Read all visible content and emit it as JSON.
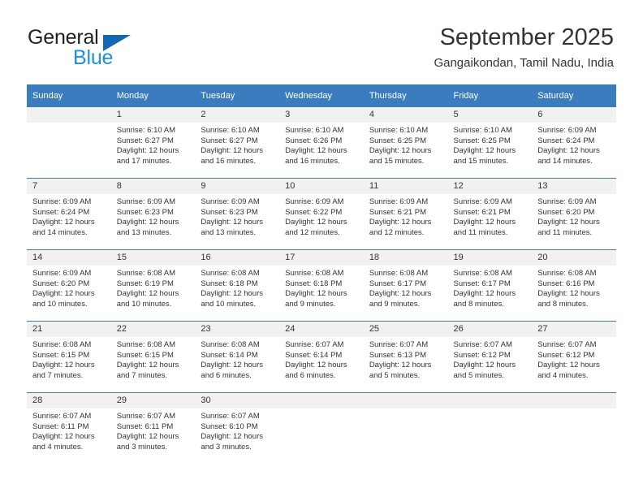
{
  "logo": {
    "text_primary": "General",
    "text_secondary": "Blue",
    "primary_color": "#231f20",
    "secondary_color": "#1d8fe0",
    "triangle_color": "#1268b3"
  },
  "header": {
    "title": "September 2025",
    "subtitle": "Gangaikondan, Tamil Nadu, India"
  },
  "calendar": {
    "header_bg": "#3a7cbe",
    "daynum_bg": "#f1f1f1",
    "weekdays": [
      "Sunday",
      "Monday",
      "Tuesday",
      "Wednesday",
      "Thursday",
      "Friday",
      "Saturday"
    ],
    "weeks": [
      [
        {
          "day": "",
          "sunrise": "",
          "sunset": "",
          "daylight1": "",
          "daylight2": ""
        },
        {
          "day": "1",
          "sunrise": "Sunrise: 6:10 AM",
          "sunset": "Sunset: 6:27 PM",
          "daylight1": "Daylight: 12 hours",
          "daylight2": "and 17 minutes."
        },
        {
          "day": "2",
          "sunrise": "Sunrise: 6:10 AM",
          "sunset": "Sunset: 6:27 PM",
          "daylight1": "Daylight: 12 hours",
          "daylight2": "and 16 minutes."
        },
        {
          "day": "3",
          "sunrise": "Sunrise: 6:10 AM",
          "sunset": "Sunset: 6:26 PM",
          "daylight1": "Daylight: 12 hours",
          "daylight2": "and 16 minutes."
        },
        {
          "day": "4",
          "sunrise": "Sunrise: 6:10 AM",
          "sunset": "Sunset: 6:25 PM",
          "daylight1": "Daylight: 12 hours",
          "daylight2": "and 15 minutes."
        },
        {
          "day": "5",
          "sunrise": "Sunrise: 6:10 AM",
          "sunset": "Sunset: 6:25 PM",
          "daylight1": "Daylight: 12 hours",
          "daylight2": "and 15 minutes."
        },
        {
          "day": "6",
          "sunrise": "Sunrise: 6:09 AM",
          "sunset": "Sunset: 6:24 PM",
          "daylight1": "Daylight: 12 hours",
          "daylight2": "and 14 minutes."
        }
      ],
      [
        {
          "day": "7",
          "sunrise": "Sunrise: 6:09 AM",
          "sunset": "Sunset: 6:24 PM",
          "daylight1": "Daylight: 12 hours",
          "daylight2": "and 14 minutes."
        },
        {
          "day": "8",
          "sunrise": "Sunrise: 6:09 AM",
          "sunset": "Sunset: 6:23 PM",
          "daylight1": "Daylight: 12 hours",
          "daylight2": "and 13 minutes."
        },
        {
          "day": "9",
          "sunrise": "Sunrise: 6:09 AM",
          "sunset": "Sunset: 6:23 PM",
          "daylight1": "Daylight: 12 hours",
          "daylight2": "and 13 minutes."
        },
        {
          "day": "10",
          "sunrise": "Sunrise: 6:09 AM",
          "sunset": "Sunset: 6:22 PM",
          "daylight1": "Daylight: 12 hours",
          "daylight2": "and 12 minutes."
        },
        {
          "day": "11",
          "sunrise": "Sunrise: 6:09 AM",
          "sunset": "Sunset: 6:21 PM",
          "daylight1": "Daylight: 12 hours",
          "daylight2": "and 12 minutes."
        },
        {
          "day": "12",
          "sunrise": "Sunrise: 6:09 AM",
          "sunset": "Sunset: 6:21 PM",
          "daylight1": "Daylight: 12 hours",
          "daylight2": "and 11 minutes."
        },
        {
          "day": "13",
          "sunrise": "Sunrise: 6:09 AM",
          "sunset": "Sunset: 6:20 PM",
          "daylight1": "Daylight: 12 hours",
          "daylight2": "and 11 minutes."
        }
      ],
      [
        {
          "day": "14",
          "sunrise": "Sunrise: 6:09 AM",
          "sunset": "Sunset: 6:20 PM",
          "daylight1": "Daylight: 12 hours",
          "daylight2": "and 10 minutes."
        },
        {
          "day": "15",
          "sunrise": "Sunrise: 6:08 AM",
          "sunset": "Sunset: 6:19 PM",
          "daylight1": "Daylight: 12 hours",
          "daylight2": "and 10 minutes."
        },
        {
          "day": "16",
          "sunrise": "Sunrise: 6:08 AM",
          "sunset": "Sunset: 6:18 PM",
          "daylight1": "Daylight: 12 hours",
          "daylight2": "and 10 minutes."
        },
        {
          "day": "17",
          "sunrise": "Sunrise: 6:08 AM",
          "sunset": "Sunset: 6:18 PM",
          "daylight1": "Daylight: 12 hours",
          "daylight2": "and 9 minutes."
        },
        {
          "day": "18",
          "sunrise": "Sunrise: 6:08 AM",
          "sunset": "Sunset: 6:17 PM",
          "daylight1": "Daylight: 12 hours",
          "daylight2": "and 9 minutes."
        },
        {
          "day": "19",
          "sunrise": "Sunrise: 6:08 AM",
          "sunset": "Sunset: 6:17 PM",
          "daylight1": "Daylight: 12 hours",
          "daylight2": "and 8 minutes."
        },
        {
          "day": "20",
          "sunrise": "Sunrise: 6:08 AM",
          "sunset": "Sunset: 6:16 PM",
          "daylight1": "Daylight: 12 hours",
          "daylight2": "and 8 minutes."
        }
      ],
      [
        {
          "day": "21",
          "sunrise": "Sunrise: 6:08 AM",
          "sunset": "Sunset: 6:15 PM",
          "daylight1": "Daylight: 12 hours",
          "daylight2": "and 7 minutes."
        },
        {
          "day": "22",
          "sunrise": "Sunrise: 6:08 AM",
          "sunset": "Sunset: 6:15 PM",
          "daylight1": "Daylight: 12 hours",
          "daylight2": "and 7 minutes."
        },
        {
          "day": "23",
          "sunrise": "Sunrise: 6:08 AM",
          "sunset": "Sunset: 6:14 PM",
          "daylight1": "Daylight: 12 hours",
          "daylight2": "and 6 minutes."
        },
        {
          "day": "24",
          "sunrise": "Sunrise: 6:07 AM",
          "sunset": "Sunset: 6:14 PM",
          "daylight1": "Daylight: 12 hours",
          "daylight2": "and 6 minutes."
        },
        {
          "day": "25",
          "sunrise": "Sunrise: 6:07 AM",
          "sunset": "Sunset: 6:13 PM",
          "daylight1": "Daylight: 12 hours",
          "daylight2": "and 5 minutes."
        },
        {
          "day": "26",
          "sunrise": "Sunrise: 6:07 AM",
          "sunset": "Sunset: 6:12 PM",
          "daylight1": "Daylight: 12 hours",
          "daylight2": "and 5 minutes."
        },
        {
          "day": "27",
          "sunrise": "Sunrise: 6:07 AM",
          "sunset": "Sunset: 6:12 PM",
          "daylight1": "Daylight: 12 hours",
          "daylight2": "and 4 minutes."
        }
      ],
      [
        {
          "day": "28",
          "sunrise": "Sunrise: 6:07 AM",
          "sunset": "Sunset: 6:11 PM",
          "daylight1": "Daylight: 12 hours",
          "daylight2": "and 4 minutes."
        },
        {
          "day": "29",
          "sunrise": "Sunrise: 6:07 AM",
          "sunset": "Sunset: 6:11 PM",
          "daylight1": "Daylight: 12 hours",
          "daylight2": "and 3 minutes."
        },
        {
          "day": "30",
          "sunrise": "Sunrise: 6:07 AM",
          "sunset": "Sunset: 6:10 PM",
          "daylight1": "Daylight: 12 hours",
          "daylight2": "and 3 minutes."
        },
        {
          "day": "",
          "sunrise": "",
          "sunset": "",
          "daylight1": "",
          "daylight2": ""
        },
        {
          "day": "",
          "sunrise": "",
          "sunset": "",
          "daylight1": "",
          "daylight2": ""
        },
        {
          "day": "",
          "sunrise": "",
          "sunset": "",
          "daylight1": "",
          "daylight2": ""
        },
        {
          "day": "",
          "sunrise": "",
          "sunset": "",
          "daylight1": "",
          "daylight2": ""
        }
      ]
    ]
  }
}
